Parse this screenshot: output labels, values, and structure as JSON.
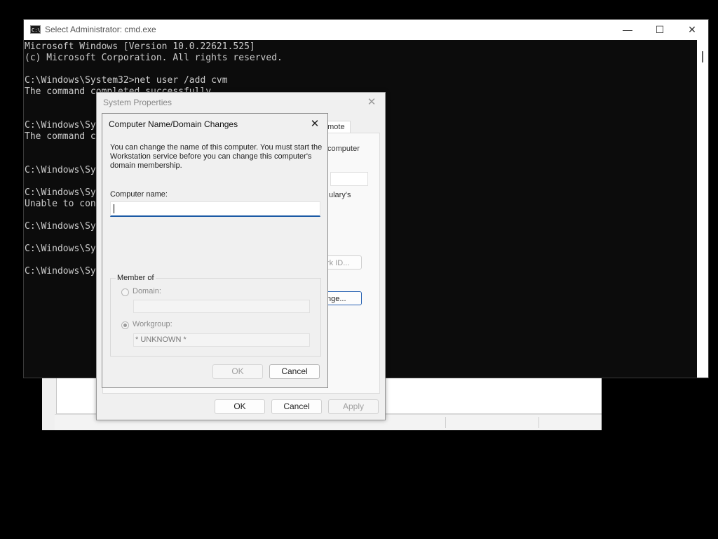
{
  "cmd_window": {
    "title": "Select Administrator: cmd.exe",
    "icon_text": "C:\\",
    "minimize_glyph": "—",
    "maximize_glyph": "☐",
    "close_glyph": "✕",
    "lines": [
      "Microsoft Windows [Version 10.0.22621.525]",
      "(c) Microsoft Corporation. All rights reserved.",
      "",
      "C:\\Windows\\System32>net user /add cvm",
      "The command completed successfully.",
      "",
      "",
      "C:\\Windows\\Sys",
      "The command c",
      "",
      "",
      "C:\\Windows\\Sys",
      "",
      "C:\\Windows\\Sys",
      "Unable to con",
      "",
      "C:\\Windows\\Sys",
      "",
      "C:\\Windows\\Sys",
      "",
      "C:\\Windows\\Sys"
    ]
  },
  "system_properties": {
    "title": "System Properties",
    "close_glyph": "✕",
    "tab_label": "emote",
    "panel_text_computer": "computer",
    "panel_text_ulary": "ulary's",
    "network_id_button": "rk ID...",
    "change_button": "nge...",
    "ok_label": "OK",
    "cancel_label": "Cancel",
    "apply_label": "Apply"
  },
  "computer_name_dialog": {
    "title": "Computer Name/Domain Changes",
    "close_glyph": "✕",
    "description": "You can change the name of this computer.  You must start the Workstation service before you can change this computer's domain membership.",
    "computer_name_label": "Computer name:",
    "computer_name_value": "",
    "member_of_label": "Member of",
    "domain_label": "Domain:",
    "domain_value": "",
    "workgroup_label": "Workgroup:",
    "workgroup_value": "* UNKNOWN *",
    "selected_membership": "workgroup",
    "ok_label": "OK",
    "cancel_label": "Cancel"
  }
}
